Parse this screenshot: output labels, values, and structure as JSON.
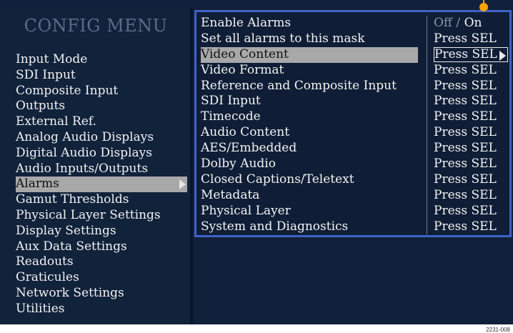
{
  "title": "CONFIG MENU",
  "left_menu": [
    {
      "label": "Input Mode"
    },
    {
      "label": "SDI Input"
    },
    {
      "label": "Composite Input"
    },
    {
      "label": "Outputs"
    },
    {
      "label": "External Ref."
    },
    {
      "label": "Analog Audio Displays"
    },
    {
      "label": "Digital Audio Displays"
    },
    {
      "label": "Audio Inputs/Outputs"
    },
    {
      "label": "Alarms",
      "selected": true
    },
    {
      "label": "Gamut Thresholds"
    },
    {
      "label": "Physical Layer Settings"
    },
    {
      "label": "Display Settings"
    },
    {
      "label": "Aux Data Settings"
    },
    {
      "label": "Readouts"
    },
    {
      "label": "Graticules"
    },
    {
      "label": "Network Settings"
    },
    {
      "label": "Utilities"
    }
  ],
  "submenu": [
    {
      "label": "Enable Alarms",
      "value_off": "Off",
      "value_sep": "/",
      "value_on": "On"
    },
    {
      "label": "Set all alarms to this mask",
      "value": "Press SEL"
    },
    {
      "label": "Video Content",
      "value": "Press SEL",
      "selected": true
    },
    {
      "label": "Video Format",
      "value": "Press SEL"
    },
    {
      "label": "Reference and Composite Input",
      "value": "Press SEL"
    },
    {
      "label": "SDI Input",
      "value": "Press SEL"
    },
    {
      "label": "Timecode",
      "value": "Press SEL"
    },
    {
      "label": "Audio Content",
      "value": "Press SEL"
    },
    {
      "label": "AES/Embedded",
      "value": "Press SEL"
    },
    {
      "label": "Dolby Audio",
      "value": "Press SEL"
    },
    {
      "label": "Closed Captions/Teletext",
      "value": "Press SEL"
    },
    {
      "label": "Metadata",
      "value": "Press SEL"
    },
    {
      "label": "Physical Layer",
      "value": "Press SEL"
    },
    {
      "label": "System and Diagnostics",
      "value": "Press SEL"
    }
  ],
  "figure_id": "2231-008",
  "colors": {
    "background": "#10203a",
    "highlight": "#a8a8a8",
    "submenu_border": "#3f62c8",
    "pin": "#f5a300"
  }
}
